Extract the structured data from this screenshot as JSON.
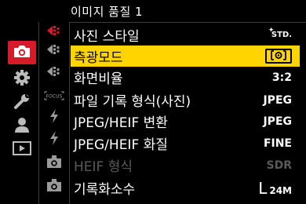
{
  "header": {
    "title": "이미지 품질 1"
  },
  "main_tabs": [
    {
      "name": "photo-icon",
      "active": true
    },
    {
      "name": "gear-icon"
    },
    {
      "name": "wrench-icon"
    },
    {
      "name": "user-icon"
    },
    {
      "name": "playback-icon"
    }
  ],
  "sub_tabs": [
    {
      "name": "image-quality-icon"
    },
    {
      "name": "focus-icon",
      "label": "FOCUS"
    },
    {
      "name": "flash-icon"
    },
    {
      "name": "flash-icon"
    },
    {
      "name": "camera-icon"
    },
    {
      "name": "camera-icon"
    }
  ],
  "menu": {
    "items": [
      {
        "label": "사진 스타일",
        "value": "STD."
      },
      {
        "label": "측광모드",
        "value": ""
      },
      {
        "label": "화면비율",
        "value": "3:2"
      },
      {
        "label": "파일 기록 형식(사진)",
        "value": "JPEG"
      },
      {
        "label": "JPEG/HEIF 변환",
        "value": "JPEG"
      },
      {
        "label": "JPEG/HEIF 화질",
        "value": "FINE"
      },
      {
        "label": "HEIF 형식",
        "value": "SDR"
      },
      {
        "label": "기록화소수",
        "value_big": "L",
        "value_small": "24M"
      }
    ],
    "selected_index": 1,
    "disabled_index": 6
  },
  "colors": {
    "accent_red": "#d51a28",
    "selection_yellow": "#ffd400",
    "background": "#000000",
    "disabled_text": "#5a5a5a"
  }
}
